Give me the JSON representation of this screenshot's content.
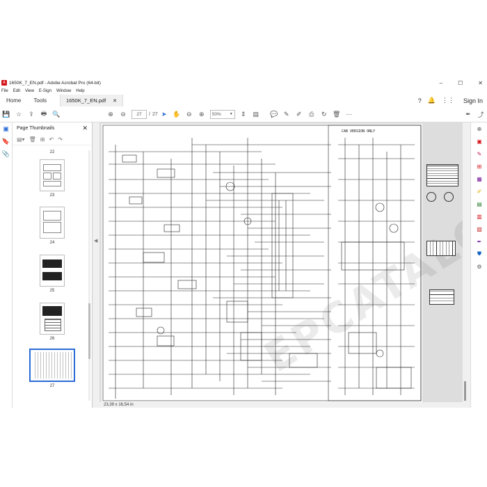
{
  "window": {
    "title": "1650K_7_EN.pdf - Adobe Acrobat Pro (64-bit)",
    "minimize": "–",
    "maximize": "☐",
    "close": "✕"
  },
  "menu": [
    "File",
    "Edit",
    "View",
    "E-Sign",
    "Window",
    "Help"
  ],
  "tabs": {
    "home": "Home",
    "tools": "Tools",
    "document": "1650K_7_EN.pdf",
    "doc_close": "✕",
    "sign_in": "Sign In"
  },
  "toolbar": {
    "page_current": "27",
    "page_separator": "/",
    "page_total": "27",
    "zoom": "50%"
  },
  "thumbnails": {
    "title": "Page Thumbnails",
    "items": [
      {
        "label": "22"
      },
      {
        "label": "23"
      },
      {
        "label": "24"
      },
      {
        "label": "25"
      },
      {
        "label": "26"
      },
      {
        "label": "27"
      }
    ]
  },
  "document": {
    "page_header": "CAB VERSION ONLY",
    "size_readout": "23,39 x 16,54 in",
    "watermark": "EPCATALOGS.COM"
  },
  "colors": {
    "accent": "#2a6ad6",
    "acrobat_red": "#d4161c"
  },
  "right_tools": [
    "search-icon",
    "export-pdf-icon",
    "edit-pdf-icon",
    "create-pdf-icon",
    "organize-icon",
    "comment-icon",
    "combine-icon",
    "compress-icon",
    "redact-icon",
    "protect-icon",
    "fill-sign-icon",
    "more-tools-icon"
  ]
}
